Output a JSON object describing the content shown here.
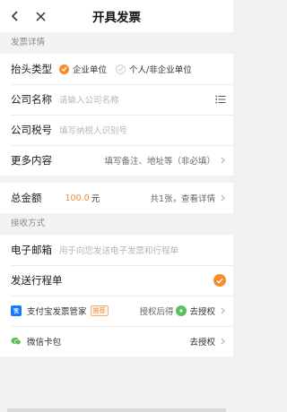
{
  "header": {
    "title": "开具发票"
  },
  "invoice_section": {
    "label": "发票详情",
    "header_type": {
      "label": "抬头类型",
      "options": [
        "企业单位",
        "个人/非企业单位"
      ],
      "selected": "企业单位"
    },
    "company_name": {
      "label": "公司名称",
      "placeholder": "请输入公司名称"
    },
    "tax_id": {
      "label": "公司税号",
      "placeholder": "填写纳税人识别号"
    },
    "more": {
      "label": "更多内容",
      "hint": "填写备注、地址等（非必填）"
    },
    "total": {
      "label": "总金额",
      "amount": "100.0",
      "unit": "元",
      "detail": "共1张，查看详情"
    }
  },
  "receive_section": {
    "label": "接收方式",
    "email": {
      "label": "电子邮箱",
      "placeholder": "用于向您发送电子发票和行程单"
    },
    "itinerary": {
      "label": "发送行程单",
      "checked": true
    },
    "alipay": {
      "label": "支付宝发票管家",
      "badge": "推荐",
      "status": "授权后得",
      "action": "去授权"
    },
    "wechat": {
      "label": "微信卡包",
      "action": "去授权"
    }
  },
  "colors": {
    "accent": "#f58b2a",
    "alipay": "#1677ff",
    "wechat": "#58c15a"
  }
}
